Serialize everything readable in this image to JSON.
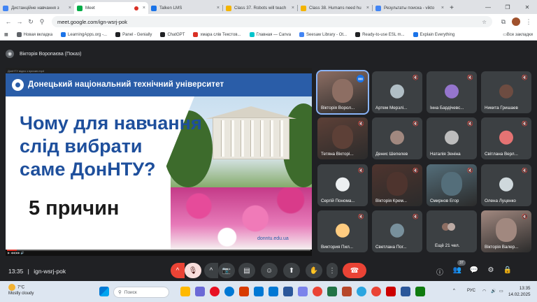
{
  "tabs": [
    {
      "title": "Дистанційне навчання з ",
      "color": "#4285f4",
      "active": false
    },
    {
      "title": "Meet",
      "color": "#00ac47",
      "active": true,
      "recording": true
    },
    {
      "title": "Talken LMS",
      "color": "#1a73e8",
      "active": false
    },
    {
      "title": "Class 37. Robots will teach",
      "color": "#f4b400",
      "active": false
    },
    {
      "title": "Class 38. Humans need hu",
      "color": "#f4b400",
      "active": false
    },
    {
      "title": "Результаты поиска - vikto",
      "color": "#4285f4",
      "active": false
    }
  ],
  "tab_close": "×",
  "new_tab": "+",
  "window_controls": {
    "minimize": "—",
    "restore": "❐",
    "close": "✕"
  },
  "address": {
    "url": "meet.google.com/ign-wsrj-pok",
    "star": "☆"
  },
  "nav": {
    "back": "←",
    "forward": "→",
    "reload": "↻",
    "extensions": "⧉",
    "menu": "⋮"
  },
  "bookmarks": [
    {
      "label": "Новая вкладка",
      "color": "#5f6368"
    },
    {
      "label": "LearningApps.org -...",
      "color": "#1a73e8"
    },
    {
      "label": "Panel - Genially",
      "color": "#202124"
    },
    {
      "label": "ChatGPT",
      "color": "#202124"
    },
    {
      "label": "хмара слів Текстов...",
      "color": "#d93025"
    },
    {
      "label": "Главная — Canva",
      "color": "#00c4cc"
    },
    {
      "label": "Seesaw Library - Ot...",
      "color": "#4285f4"
    },
    {
      "label": "Ready-to-use ESL m...",
      "color": "#202124"
    },
    {
      "label": "Explain Everything",
      "color": "#1a73e8"
    }
  ],
  "all_bookmarks": "Все закладки",
  "presenter": {
    "label": "Вікторія Воропаєва (Показ)"
  },
  "slide": {
    "player_title": "ДонНТУ відео з причин.mp4",
    "university": "Донецький національний технічний університет",
    "lines": [
      "Чому для навчання",
      "слід вибрати",
      "саме ДонНТУ?"
    ],
    "reasons": "5 причин",
    "site": "donntu.edu.ua"
  },
  "participants": [
    {
      "name": "Вікторія Ворол...",
      "color": "#8d6e63",
      "speaking": true,
      "video": true
    },
    {
      "name": "Артем Мерзлі...",
      "color": "#b0bec5"
    },
    {
      "name": "Інна Бардічевс...",
      "color": "#9575cd"
    },
    {
      "name": "Никита Гришаев",
      "color": "#6d4c41"
    },
    {
      "name": "Тетяна Вікторі...",
      "color": "#5d4037",
      "video": true
    },
    {
      "name": "Денис Шепелев",
      "color": "#a1887f"
    },
    {
      "name": "Наталія Зеніна",
      "color": "#bdbdbd"
    },
    {
      "name": "Світлана Верл...",
      "color": "#e57373"
    },
    {
      "name": "Сергій Пономa...",
      "color": "#eceff1"
    },
    {
      "name": "Вікторія Крем...",
      "color": "#4e342e",
      "video": true
    },
    {
      "name": "Смирнов Егор",
      "color": "#546e7a",
      "video": true
    },
    {
      "name": "Олена Луценко",
      "color": "#cfd8dc"
    },
    {
      "name": "Виктория Пил...",
      "color": "#ffcc80"
    },
    {
      "name": "Светлана Пог...",
      "color": "#78909c"
    },
    {
      "name": "Ещё 21 чел.",
      "color": "#424242",
      "more": true
    },
    {
      "name": "Вікторія Валер...",
      "color": "#a1887f",
      "video": true
    }
  ],
  "controls": {
    "time": "13:35",
    "code": "ign-wsrj-pok",
    "up": "^",
    "mic": "🎙",
    "cam": "📷",
    "cc": "▤",
    "emoji": "☺",
    "present": "⬆",
    "hand": "✋",
    "more": "⋮",
    "hangup": "☎",
    "info": "ⓘ",
    "people": "👥",
    "people_count": "37",
    "chat": "💬",
    "activities": "⚙",
    "host": "🔒"
  },
  "taskbar": {
    "temp": "7°C",
    "weather": "Mostly cloudy",
    "search": "Поиск",
    "lang": "РУС",
    "time": "13:35",
    "date": "14.02.2025"
  }
}
